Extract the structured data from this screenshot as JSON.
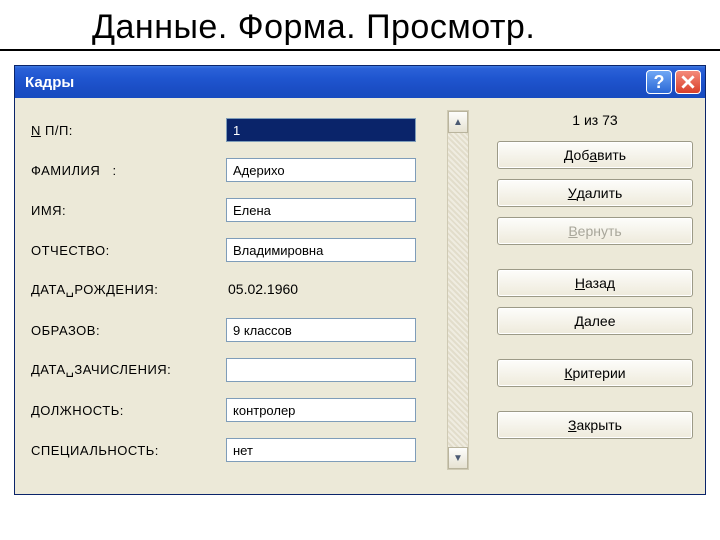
{
  "page": {
    "heading": "Данные. Форма. Просмотр."
  },
  "window": {
    "title": "Кадры",
    "help_glyph": "?",
    "counter": "1 из 73"
  },
  "labels": {
    "npp_prefix": "N",
    "npp_rest": " П/П:",
    "surname": "ФАМИЛИЯ   :",
    "name": "ИМЯ:",
    "patronymic": "ОТЧЕСТВО:",
    "birthdate": "ДАТА␣РОЖДЕНИЯ:",
    "education": "ОБРАЗОВ:",
    "enrolldate": "ДАТА␣ЗАЧИСЛЕНИЯ:",
    "position": "ДОЛЖНОСТЬ:",
    "specialty": "СПЕЦИАЛЬНОСТЬ:"
  },
  "values": {
    "npp": "1",
    "surname": "Адерихо",
    "name": "Елена",
    "patronymic": "Владимировна",
    "birthdate": "05.02.1960",
    "education": "9 классов",
    "enrolldate": "",
    "position": "контролер",
    "specialty": "нет"
  },
  "buttons": {
    "add_u": "а",
    "add_pre": "Доб",
    "add_post": "вить",
    "delete_u": "У",
    "delete_rest": "далить",
    "restore_u": "В",
    "restore_rest": "ернуть",
    "back_u": "Н",
    "back_rest": "азад",
    "next_u": "Д",
    "next_rest": "алее",
    "criteria_u": "К",
    "criteria_rest": "ритерии",
    "close_u": "З",
    "close_rest": "акрыть"
  }
}
